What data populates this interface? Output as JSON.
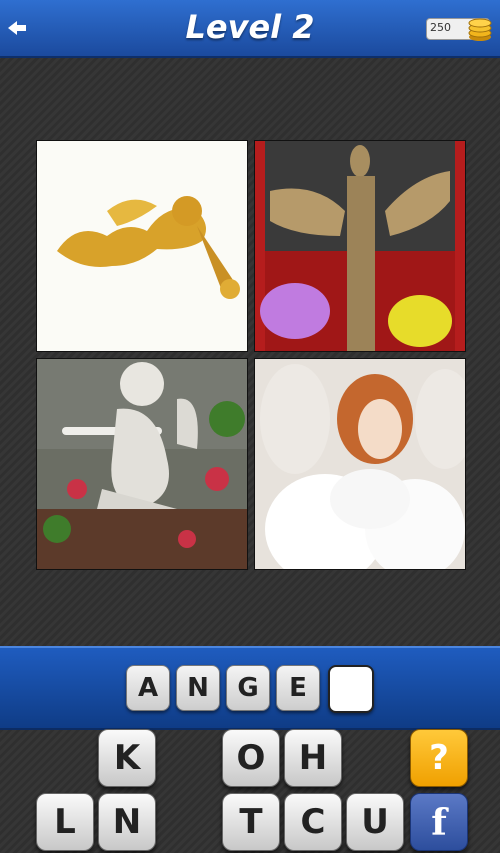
{
  "header": {
    "title": "Level 2",
    "coins": "250",
    "back_icon": "back-arrow-icon",
    "coin_icon": "coin-stack-icon"
  },
  "photos": [
    {
      "name": "golden-cherub-ornament"
    },
    {
      "name": "straw-angel-statue"
    },
    {
      "name": "stone-cherub-flute"
    },
    {
      "name": "angel-doll-fur"
    }
  ],
  "answer": {
    "letters": [
      "A",
      "N",
      "G",
      "E",
      ""
    ]
  },
  "keys": {
    "row1": [
      "K",
      "",
      "O",
      "H",
      "",
      "?"
    ],
    "row2": [
      "L",
      "N",
      "",
      "T",
      "C",
      "U",
      "f"
    ]
  },
  "colors": {
    "header_blue": "#2f6fd0",
    "hint_orange": "#f0a000",
    "facebook_blue": "#3b5998"
  }
}
